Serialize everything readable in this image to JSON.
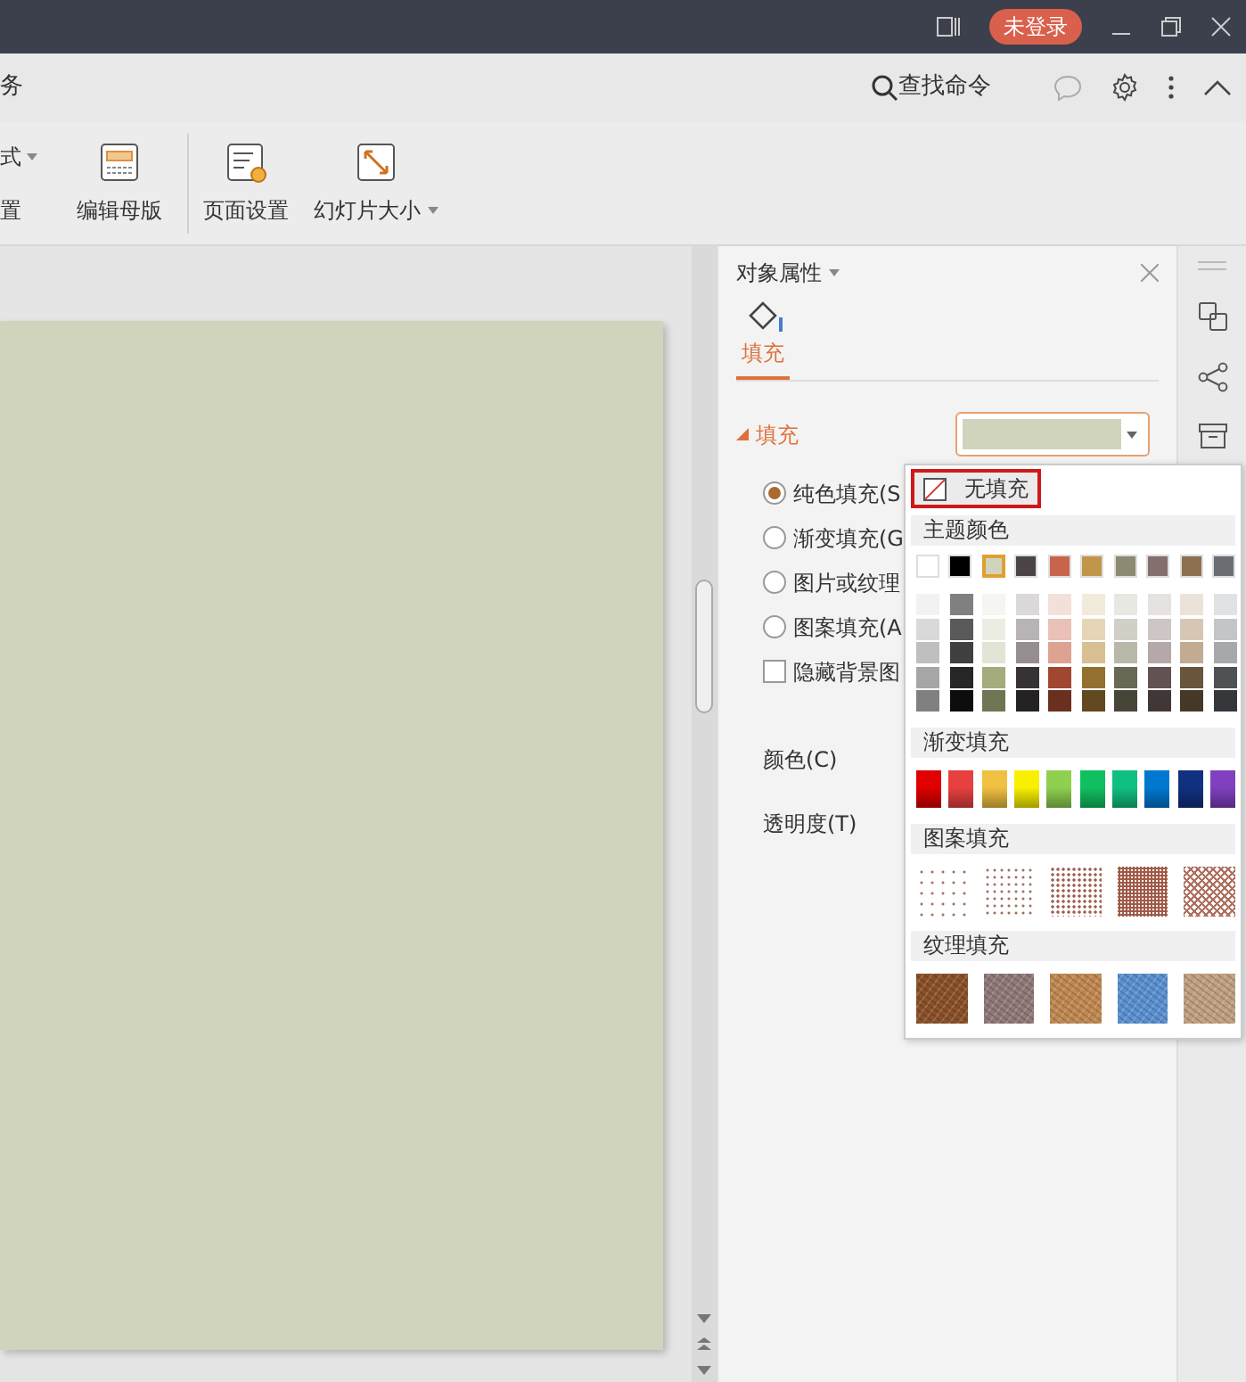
{
  "title_bar": {
    "account_button": "未登录"
  },
  "tab_bar": {
    "cut_tab": "务",
    "search": "查找命令"
  },
  "ribbon": {
    "partial_items": [
      {
        "label": "式",
        "dropdown": true
      },
      {
        "label": "置",
        "dropdown": false
      }
    ],
    "buttons": [
      {
        "kind": "master",
        "label": "编辑母版",
        "dropdown": false,
        "separator_before": false
      },
      {
        "kind": "page",
        "label": "页面设置",
        "dropdown": false,
        "separator_before": true
      },
      {
        "kind": "size",
        "label": "幻灯片大小",
        "dropdown": true,
        "separator_before": false
      }
    ]
  },
  "panel": {
    "title": "对象属性",
    "tabs": [
      {
        "label": "填充",
        "selected": true
      }
    ],
    "section": {
      "label": "填充",
      "expanded": true
    },
    "fill_swatch": {
      "color": "#d0d4bc"
    },
    "dropdown_open": true,
    "options": [
      {
        "kind": "radio",
        "label": "纯色填充(S",
        "checked": true
      },
      {
        "kind": "radio",
        "label": "渐变填充(G",
        "checked": false
      },
      {
        "kind": "radio",
        "label": "图片或纹理",
        "checked": false
      },
      {
        "kind": "radio",
        "label": "图案填充(A",
        "checked": false
      },
      {
        "kind": "checkbox",
        "label": "隐藏背景图",
        "checked": false
      }
    ],
    "fields": [
      {
        "label": "颜色(C)"
      },
      {
        "label": "透明度(T)"
      }
    ]
  },
  "popup": {
    "no_fill": {
      "label": "无填充",
      "highlighted": true
    },
    "theme": {
      "label": "主题颜色",
      "colors": [
        {
          "color": "#ffffff",
          "selected": false
        },
        {
          "color": "#000000",
          "selected": false
        },
        {
          "color": "#d0d4bc",
          "selected": true
        },
        {
          "color": "#4a4446",
          "selected": false
        },
        {
          "color": "#c8644a",
          "selected": false
        },
        {
          "color": "#c0964a",
          "selected": false
        },
        {
          "color": "#8c8a70",
          "selected": false
        },
        {
          "color": "#846e6e",
          "selected": false
        },
        {
          "color": "#8c7050",
          "selected": false
        },
        {
          "color": "#6a6e72",
          "selected": false
        }
      ],
      "shade_rows": [
        [
          {
            "color": "#f2f2f2"
          },
          {
            "color": "#808080"
          },
          {
            "color": "#f5f6f1"
          },
          {
            "color": "#dcd9da"
          },
          {
            "color": "#f4e0db"
          },
          {
            "color": "#f2eadb"
          },
          {
            "color": "#e8e8e2"
          },
          {
            "color": "#e6e2e2"
          },
          {
            "color": "#ebe3da"
          },
          {
            "color": "#e1e2e3"
          }
        ],
        [
          {
            "color": "#d9d9d9"
          },
          {
            "color": "#595959"
          },
          {
            "color": "#ebede3"
          },
          {
            "color": "#b8b3b5"
          },
          {
            "color": "#e9c1b7"
          },
          {
            "color": "#e6d5b7"
          },
          {
            "color": "#d1d0c6"
          },
          {
            "color": "#cec5c5"
          },
          {
            "color": "#d6c7b5"
          },
          {
            "color": "#c3c5c7"
          }
        ],
        [
          {
            "color": "#bfbfbf"
          },
          {
            "color": "#404040"
          },
          {
            "color": "#e2e4d6"
          },
          {
            "color": "#958d90"
          },
          {
            "color": "#dea292"
          },
          {
            "color": "#d9c092"
          },
          {
            "color": "#bab9a9"
          },
          {
            "color": "#b5a8a8"
          },
          {
            "color": "#c2ab90"
          },
          {
            "color": "#a6a8ab"
          }
        ],
        [
          {
            "color": "#a6a6a6"
          },
          {
            "color": "#262626"
          },
          {
            "color": "#a4ab7c"
          },
          {
            "color": "#373334"
          },
          {
            "color": "#a14630"
          },
          {
            "color": "#94702e"
          },
          {
            "color": "#696854"
          },
          {
            "color": "#635252"
          },
          {
            "color": "#69543c"
          },
          {
            "color": "#4f5255"
          }
        ],
        [
          {
            "color": "#808080"
          },
          {
            "color": "#0d0d0d"
          },
          {
            "color": "#6e7552"
          },
          {
            "color": "#252223"
          },
          {
            "color": "#6b2f20"
          },
          {
            "color": "#63491f"
          },
          {
            "color": "#464538"
          },
          {
            "color": "#423737"
          },
          {
            "color": "#463828"
          },
          {
            "color": "#35373a"
          }
        ]
      ]
    },
    "gradient": {
      "label": "渐变填充",
      "swatches": [
        {
          "color": "#e00000"
        },
        {
          "color": "#e84040"
        },
        {
          "color": "#f0c040"
        },
        {
          "color": "#f8f000"
        },
        {
          "color": "#90d050"
        },
        {
          "color": "#10c060"
        },
        {
          "color": "#10c080"
        },
        {
          "color": "#0078d0"
        },
        {
          "color": "#103080"
        },
        {
          "color": "#8040c0"
        }
      ]
    },
    "pattern": {
      "label": "图案填充",
      "swatches": [
        {
          "kind": "sparse"
        },
        {
          "kind": "light"
        },
        {
          "kind": "medium"
        },
        {
          "kind": "dense"
        },
        {
          "kind": "crosshatch"
        }
      ]
    },
    "texture": {
      "label": "纹理填充",
      "swatches": [
        {
          "color": "#8a5028"
        },
        {
          "color": "#907878"
        },
        {
          "color": "#c08850"
        },
        {
          "color": "#5a90d0"
        },
        {
          "color": "#c0a080"
        }
      ]
    }
  }
}
